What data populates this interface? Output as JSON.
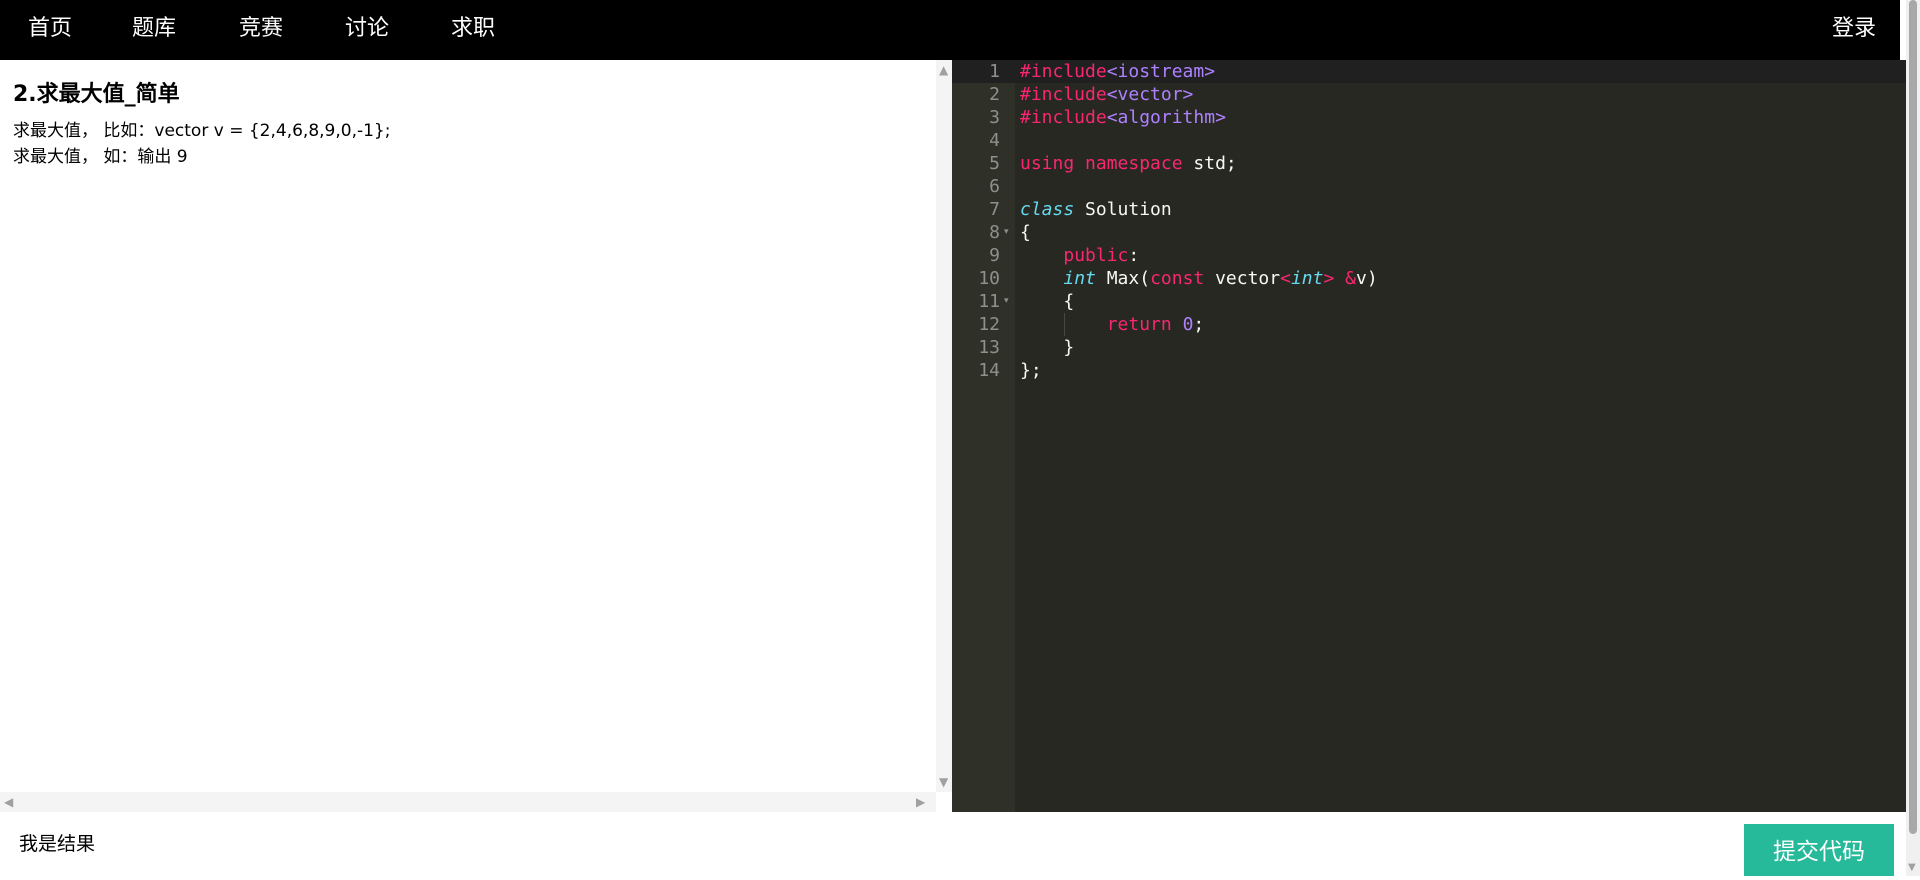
{
  "nav": {
    "items": [
      {
        "label": "首页"
      },
      {
        "label": "题库"
      },
      {
        "label": "竞赛"
      },
      {
        "label": "讨论"
      },
      {
        "label": "求职"
      }
    ],
    "login_label": "登录"
  },
  "problem": {
    "title": "2.求最大值_简单",
    "desc": [
      "求最大值， 比如：vector v = {2,4,6,8,9,0,-1};",
      "求最大值， 如：输出 9"
    ]
  },
  "editor": {
    "theme": "monokai",
    "line_numbers": [
      "1",
      "2",
      "3",
      "4",
      "5",
      "6",
      "7",
      "8",
      "9",
      "10",
      "11",
      "12",
      "13",
      "14"
    ],
    "code": {
      "l1_kw": "#include",
      "l1_arg": "<iostream>",
      "l2_kw": "#include",
      "l2_arg": "<vector>",
      "l3_kw": "#include",
      "l3_arg": "<algorithm>",
      "l5_using": "using",
      "l5_namespace": "namespace",
      "l5_rest": " std;",
      "l7_class": "class",
      "l7_rest": " Solution",
      "l8": "{",
      "l9_public": "public",
      "l9_colon": ":",
      "l10_int": "int",
      "l10_max": " Max(",
      "l10_const": "const",
      "l10_vector": " vector",
      "l10_lt": "<",
      "l10_int2": "int",
      "l10_gt": ">",
      "l10_amp": "&",
      "l10_v": "v)",
      "l11": "{",
      "l12_return": "return",
      "l12_zero": "0",
      "l12_semi": ";",
      "l13": "}",
      "l14": "};"
    }
  },
  "result": {
    "text": "我是结果"
  },
  "submit": {
    "label": "提交代码"
  },
  "colors": {
    "navbar_bg": "#000000",
    "editor_bg": "#272822",
    "submit_bg": "#26b99a"
  }
}
